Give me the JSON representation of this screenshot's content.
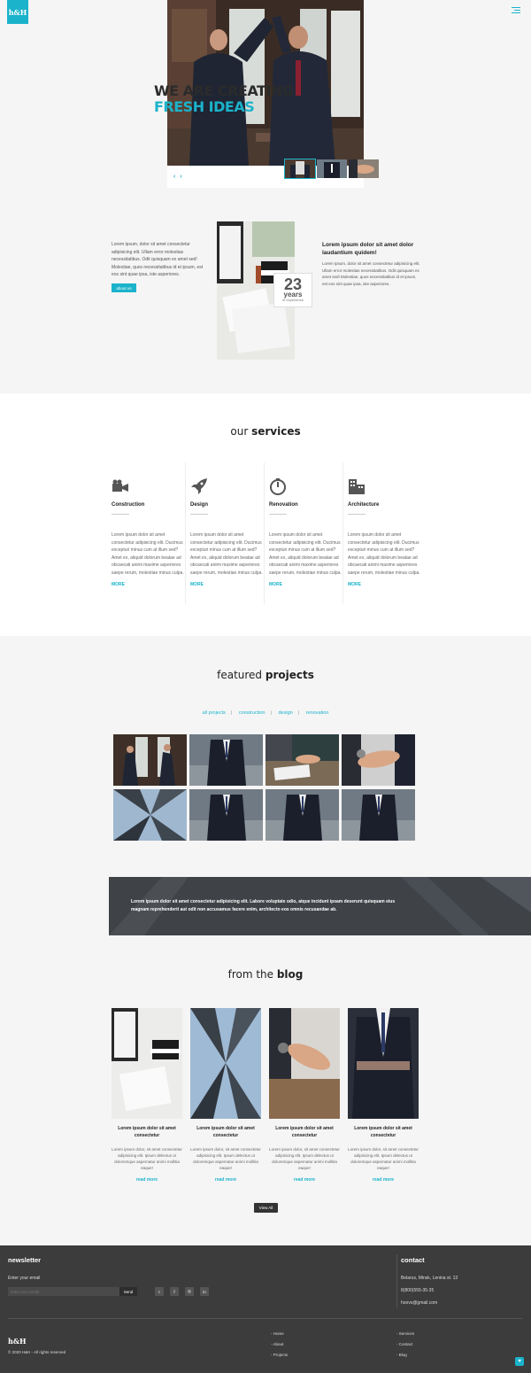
{
  "brand": {
    "logo": "h&H"
  },
  "hero": {
    "line1": "WE ARE CREATING",
    "line2": "FRESH IDEAS",
    "prev": "‹",
    "next": "›"
  },
  "about": {
    "text": "Lorem ipsum, dolor sit amet consectetur adipisicing elit. Ullam error molestias necessitatibus. Odit quisquam ex amet sed! Molestiae, quos necessitatibus id et ipsum, est eos sint quae ipsa, iste asperiores.",
    "button": "about us",
    "years_number": "23",
    "years_label": "years",
    "years_sub": "of experience",
    "quote_title": "Lorem ipsum dolor sit amet dolor laudantium quidem!",
    "quote_text": "Lorem ipsum, dolor sit amet consectetur adipisicing elit. Ullam error molestias necessitatibus. Odit quisquam ex amet sed! Molestiae, quos necessitatibus id et ipsum, est eos sint quae ipsa, iste asperiores."
  },
  "services": {
    "title_light": "our ",
    "title_bold": "services",
    "items": [
      {
        "name": "Construction",
        "icon": "camera-icon",
        "text": "Lorem ipsum dolor sit amet consectetur adipisicing elit. Ducimus excepturi minus cum at illum sed? Amet ex, aliquid dolorum beatae ad obcaecati animi maxime asperiores saepe rerum, molestiae minus culpa.",
        "more": "MORE"
      },
      {
        "name": "Design",
        "icon": "rocket-icon",
        "text": "Lorem ipsum dolor sit amet consectetur adipisicing elit. Ducimus excepturi minus cum at illum sed? Amet ex, aliquid dolorum beatae ad obcaecati animi maxime asperiores saepe rerum, molestiae minus culpa.",
        "more": "MORE"
      },
      {
        "name": "Renovation",
        "icon": "gauge-icon",
        "text": "Lorem ipsum dolor sit amet consectetur adipisicing elit. Ducimus excepturi minus cum at illum sed? Amet ex, aliquid dolorum beatae ad obcaecati animi maxime asperiores saepe rerum, molestiae minus culpa.",
        "more": "MORE"
      },
      {
        "name": "Architecture",
        "icon": "building-icon",
        "text": "Lorem ipsum dolor sit amet consectetur adipisicing elit. Ducimus excepturi minus cum at illum sed? Amet ex, aliquid dolorum beatae ad obcaecati animi maxime asperiores saepe rerum, molestiae minus culpa.",
        "more": "MORE"
      }
    ]
  },
  "projects": {
    "title_light": "featured ",
    "title_bold": "projects",
    "filters": [
      "all projects",
      "construction",
      "design",
      "renovation"
    ]
  },
  "banner": {
    "text": "Lorem ipsum dolor sit amet consectetur adipisicing elit. Labore voluptate odio, atque incidunt ipsam deserunt quisquam eius magnam reprehenderit aut odit non accusamus facere enim, architecto eos omnis recusandae ab."
  },
  "blog": {
    "title_light": "from the ",
    "title_bold": "blog",
    "posts": [
      {
        "title": "Lorem ipsum dolor sit amet consectetur",
        "text": "Lorem ipsum dolor, sit amet consectetur adipisicing elit. Ipsum delectus ut doloremque aspernatur animi mollitia eaque!",
        "more": "read more"
      },
      {
        "title": "Lorem ipsum dolor sit amet consectetur",
        "text": "Lorem ipsum dolor, sit amet consectetur adipisicing elit. Ipsum delectus ut doloremque aspernatur animi mollitia eaque!",
        "more": "read more"
      },
      {
        "title": "Lorem ipsum dolor sit amet consectetur",
        "text": "Lorem ipsum dolor, sit amet consectetur adipisicing elit. Ipsum delectus ut doloremque aspernatur animi mollitia eaque!",
        "more": "read more"
      },
      {
        "title": "Lorem ipsum dolor sit amet consectetur",
        "text": "Lorem ipsum dolor, sit amet consectetur adipisicing elit. Ipsum delectus ut doloremque aspernatur animi mollitia eaque!",
        "more": "read more"
      }
    ],
    "view_all": "View All"
  },
  "footer": {
    "newsletter_title": "newsletter",
    "email_label": "Enter your email",
    "email_placeholder": "enter your email",
    "send": "Send",
    "social": [
      "twitter-icon",
      "facebook-icon",
      "instagram-icon",
      "linkedin-icon"
    ],
    "contact_title": "contact",
    "address": "Belarus, Minsk, Lenina st. 13",
    "phone": "8(800)555-35-35",
    "email": "hoovs@gmail.com",
    "logo": "h&H",
    "copyright": "© 2020 H&H - All rights reserved",
    "links_col1": [
      "- Home",
      "- About",
      "- Projects"
    ],
    "links_col2": [
      "- Services",
      "- Contact",
      "- Blog"
    ]
  },
  "colors": {
    "accent": "#1bb3cb",
    "dark": "#3c3c3c"
  }
}
